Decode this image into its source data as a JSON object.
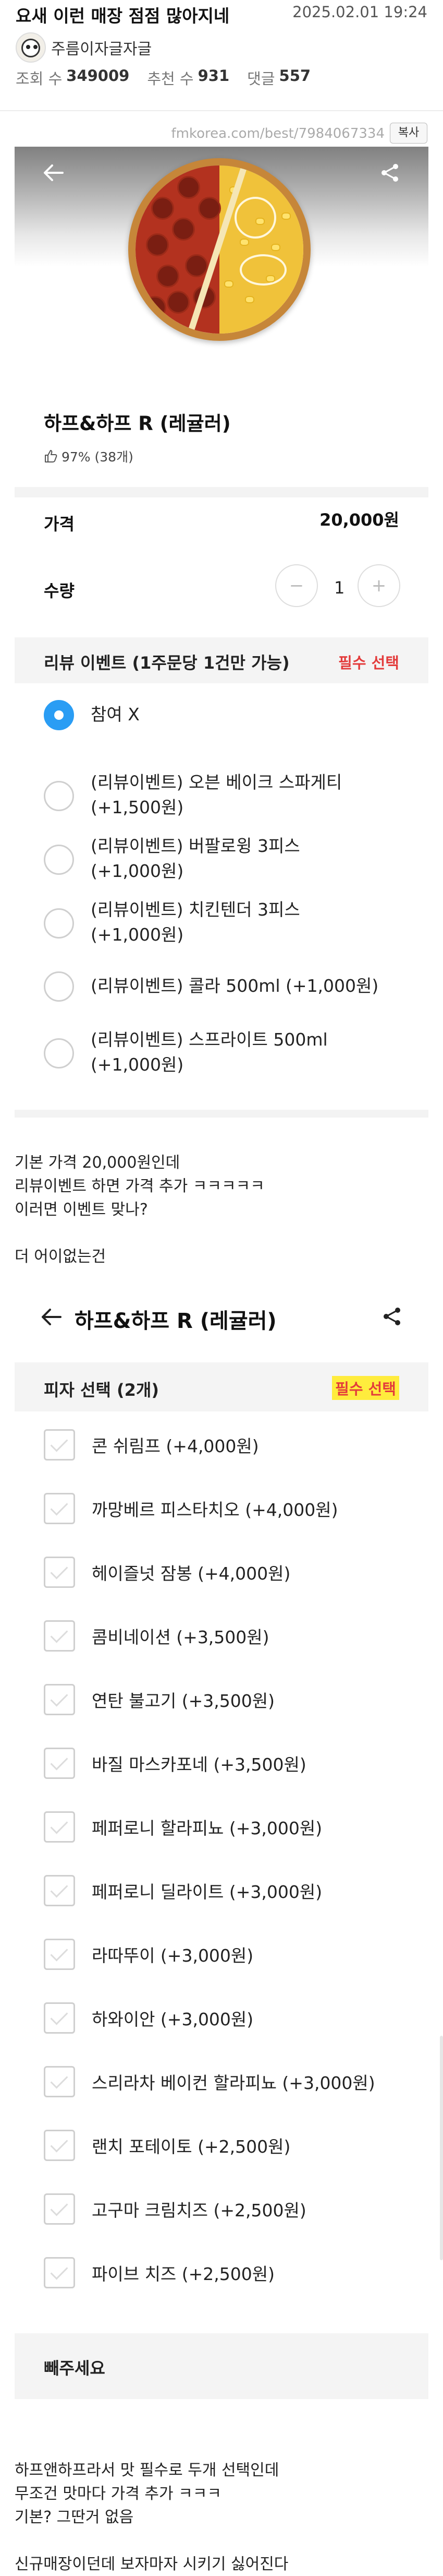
{
  "post": {
    "title": "요새 이런 매장 점점 많아지네",
    "date": "2025.02.01 19:24",
    "author": "주름이자글자글",
    "views_label": "조회 수",
    "views": "349009",
    "likes_label": "추천 수",
    "likes": "931",
    "comments_label": "댓글",
    "comments": "557",
    "url": "fmkorea.com/best/7984067334",
    "copy_label": "복사"
  },
  "product": {
    "name": "하프&하프 R (레귤러)",
    "rating": "97% (38개)",
    "price_label": "가격",
    "price": "20,000원",
    "qty_label": "수량",
    "qty": "1",
    "minus": "−",
    "plus": "+"
  },
  "review_event": {
    "title": "리뷰 이벤트 (1주문당 1건만 가능)",
    "required": "필수 선택",
    "options": [
      {
        "line1": "참여 X",
        "line2": ""
      },
      {
        "line1": "(리뷰이벤트) 오븐 베이크 스파게티",
        "line2": "(+1,500원)"
      },
      {
        "line1": "(리뷰이벤트) 버팔로윙 3피스",
        "line2": "(+1,000원)"
      },
      {
        "line1": "(리뷰이벤트) 치킨텐더 3피스",
        "line2": "(+1,000원)"
      },
      {
        "line1": "(리뷰이벤트) 콜라 500ml (+1,000원)",
        "line2": ""
      },
      {
        "line1": "(리뷰이벤트) 스프라이트 500ml",
        "line2": "(+1,000원)"
      }
    ],
    "selected_index": 0
  },
  "comment1": {
    "lines": [
      "기본 가격 20,000원인데",
      "리뷰이벤트 하면 가격 추가 ㅋㅋㅋㅋㅋ",
      "이러면 이벤트 맞나?"
    ],
    "line4": "더 어이없는건"
  },
  "pizza_select": {
    "bar_title": "하프&하프 R (레귤러)",
    "title": "피자 선택 (2개)",
    "required": "필수 선택",
    "options": [
      "콘 쉬림프 (+4,000원)",
      "까망베르 피스타치오 (+4,000원)",
      "헤이즐넛 잠봉 (+4,000원)",
      "콤비네이션 (+3,500원)",
      "연탄 불고기 (+3,500원)",
      "바질 마스카포네 (+3,500원)",
      "페퍼로니 할라피뇨 (+3,000원)",
      "페퍼로니 딜라이트 (+3,000원)",
      "라따뚜이 (+3,000원)",
      "하와이안 (+3,000원)",
      "스리라차 베이컨 할라피뇨 (+3,000원)",
      "랜치 포테이토 (+2,500원)",
      "고구마 크림치즈 (+2,500원)",
      "파이브 치즈 (+2,500원)"
    ],
    "footer_title": "빼주세요"
  },
  "comment2": {
    "lines": [
      "하프앤하프라서 맛 필수로 두개 선택인데",
      "무조건 맛마다 가격 추가 ㅋㅋㅋ",
      "기본? 그딴거 없음"
    ],
    "last": "신규매장이던데 보자마자 시키기 싫어진다"
  },
  "colors": {
    "accent_blue": "#2a9df4",
    "required_red": "#e33b3b",
    "highlight_yellow": "#ffec3d"
  }
}
